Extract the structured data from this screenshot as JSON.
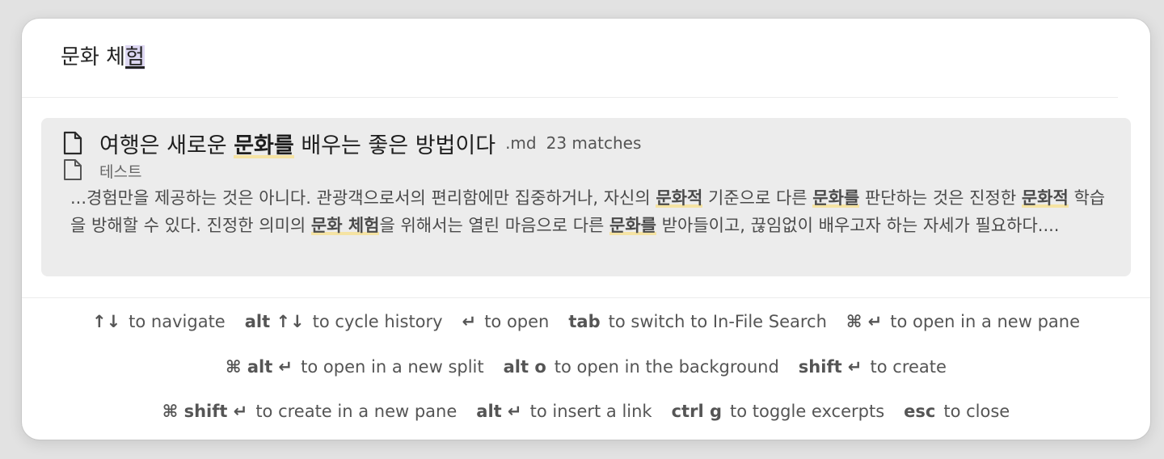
{
  "search": {
    "query_prefix": "문화 체",
    "query_composing": "험"
  },
  "result": {
    "title_before": "여행은 새로운 ",
    "title_highlight": "문화를",
    "title_after": " 배우는 좋은 방법이다",
    "extension": ".md",
    "match_count": "23 matches",
    "path": "테스트",
    "excerpt": [
      {
        "t": "...경험만을 제공하는 것은 아니다. 관광객으로서의 편리함에만 집중하거나, 자신의 "
      },
      {
        "t": "문화적",
        "hl": true
      },
      {
        "t": " 기준으로 다른 "
      },
      {
        "t": "문화를",
        "hl": true
      },
      {
        "t": " 판단하는 것은 진정한 "
      },
      {
        "t": "문화적",
        "hl": true
      },
      {
        "t": " 학습을 방해할 수 있다. 진정한 의미의 "
      },
      {
        "t": "문화 체험",
        "hl": true
      },
      {
        "t": "을 위해서는 열린 마음으로 다른 "
      },
      {
        "t": "문화를",
        "hl": true
      },
      {
        "t": " 받아들이고, 끊임없이 배우고자 하는 자세가 필요하다...."
      }
    ]
  },
  "instructions": [
    [
      {
        "key": "↑↓",
        "label": "to navigate"
      },
      {
        "key": "alt ↑↓",
        "label": "to cycle history"
      },
      {
        "key": "↵",
        "label": "to open"
      },
      {
        "key": "tab",
        "label": "to switch to In-File Search"
      },
      {
        "key": "⌘ ↵",
        "label": "to open in a new pane"
      }
    ],
    [
      {
        "key": "⌘ alt ↵",
        "label": "to open in a new split"
      },
      {
        "key": "alt o",
        "label": "to open in the background"
      },
      {
        "key": "shift ↵",
        "label": "to create"
      }
    ],
    [
      {
        "key": "⌘ shift ↵",
        "label": "to create in a new pane"
      },
      {
        "key": "alt ↵",
        "label": "to insert a link"
      },
      {
        "key": "ctrl g",
        "label": "to toggle excerpts"
      },
      {
        "key": "esc",
        "label": "to close"
      }
    ]
  ],
  "icons": {
    "result_icon": "file-icon",
    "path_icon": "file-icon"
  },
  "colors": {
    "highlight_underline": "#f5e3a3",
    "selected_result_bg": "#ececec",
    "composing_bg": "#ddd7f2"
  }
}
